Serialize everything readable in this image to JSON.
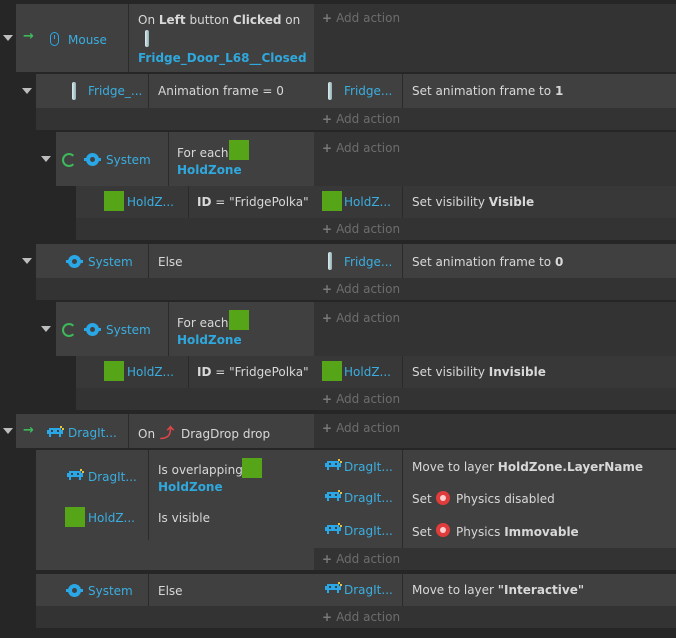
{
  "common": {
    "add_action": "Add action",
    "plus": "+"
  },
  "events": {
    "e1": {
      "object": "Mouse",
      "cond_prefix": "On",
      "cond_button": "Left",
      "cond_mid": "button",
      "cond_state": "Clicked",
      "cond_on": "on",
      "cond_target": "Fridge_Door_L68__Closed"
    },
    "s1": {
      "object": "Fridge_...",
      "condition": "Animation frame = 0",
      "act_object": "Fridge...",
      "act_text": "Set animation frame to",
      "act_value": "1"
    },
    "s1a": {
      "object": "System",
      "cond_text": "For each",
      "cond_object": "HoldZone"
    },
    "s1b": {
      "object": "HoldZ...",
      "cond_id": "ID",
      "cond_value": "= \"FridgePolka\"",
      "act_object": "HoldZ...",
      "act_text": "Set visibility",
      "act_value": "Visible"
    },
    "s2": {
      "object": "System",
      "condition": "Else",
      "act_object": "Fridge...",
      "act_text": "Set animation frame to",
      "act_value": "0"
    },
    "s2a": {
      "object": "System",
      "cond_text": "For each",
      "cond_object": "HoldZone"
    },
    "s2b": {
      "object": "HoldZ...",
      "cond_id": "ID",
      "cond_value": "= \"FridgePolka\"",
      "act_object": "HoldZ...",
      "act_text": "Set visibility",
      "act_value": "Invisible"
    },
    "e2": {
      "object": "DragIt...",
      "cond_prefix": "On",
      "cond_text": "DragDrop drop"
    },
    "s3": {
      "object1": "DragIt...",
      "cond1_text": "Is overlapping",
      "cond1_object": "HoldZone",
      "object2": "HoldZ...",
      "cond2_text": "Is visible",
      "act1_object": "DragIt...",
      "act1_text": "Move to layer",
      "act1_value": "HoldZone.LayerName",
      "act2_object": "DragIt...",
      "act2_set": "Set",
      "act2_text": "Physics disabled",
      "act3_object": "DragIt...",
      "act3_set": "Set",
      "act3_text": "Physics",
      "act3_value": "Immovable"
    },
    "s4": {
      "object": "System",
      "condition": "Else",
      "act_object": "DragIt...",
      "act_text": "Move to layer",
      "act_value": "\"Interactive\""
    }
  }
}
